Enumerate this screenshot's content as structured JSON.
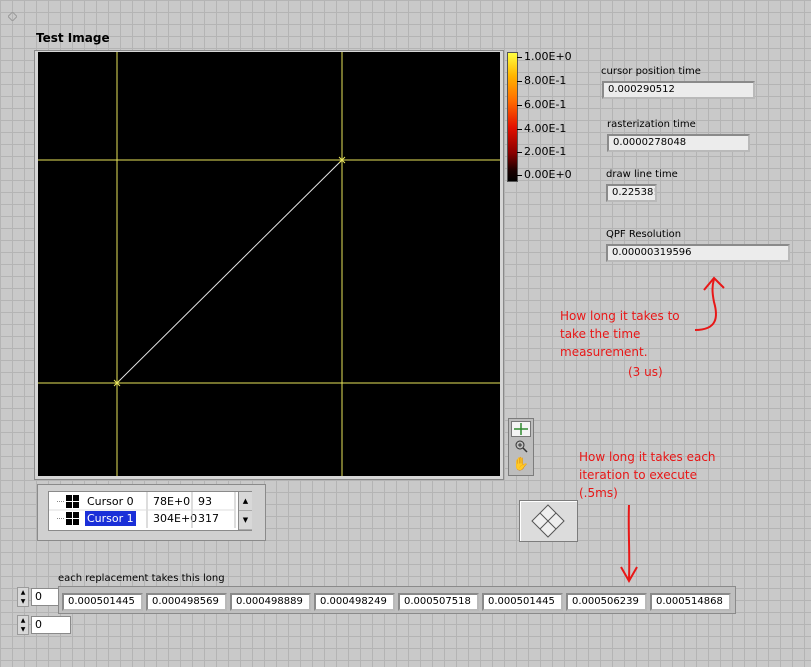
{
  "graph": {
    "title": "Test Image",
    "colorbar_ticks": [
      "1.00E+0",
      "8.00E-1",
      "6.00E-1",
      "4.00E-1",
      "2.00E-1",
      "0.00E+0"
    ]
  },
  "indicators": {
    "cursor_position": {
      "label": "cursor position time",
      "value": "0.000290512"
    },
    "rasterization": {
      "label": "rasterization time",
      "value": "0.0000278048"
    },
    "draw_line": {
      "label": "draw line time",
      "value": "0.22538!"
    },
    "qpf": {
      "label": "QPF Resolution",
      "value": "0.00000319596"
    }
  },
  "annotations": {
    "note1": [
      "How long it takes to",
      "take the time",
      "measurement."
    ],
    "note1_value": "(3 us)",
    "note2": [
      "How long it takes each",
      "iteration to execute",
      "(.5ms)"
    ]
  },
  "cursor_legend": [
    {
      "name": "Cursor 0",
      "x": "78E+0",
      "y": "93",
      "selected": false
    },
    {
      "name": "Cursor 1",
      "x": "304E+0",
      "y": "317",
      "selected": true
    }
  ],
  "array": {
    "label": "each replacement takes this long",
    "index_row": "0",
    "index_col": "0",
    "values": [
      "0.000501445",
      "0.000498569",
      "0.000498889",
      "0.000498249",
      "0.000507518",
      "0.000501445",
      "0.000506239",
      "0.000514868"
    ]
  },
  "colors": {
    "cursor": "#e8e45a",
    "annotation": "#e81717",
    "selection": "#1a2fd8"
  },
  "icons": {
    "palette": [
      "cursor-move-icon",
      "zoom-icon",
      "pan-hand-icon"
    ],
    "button": "diamond-arrows-icon"
  }
}
